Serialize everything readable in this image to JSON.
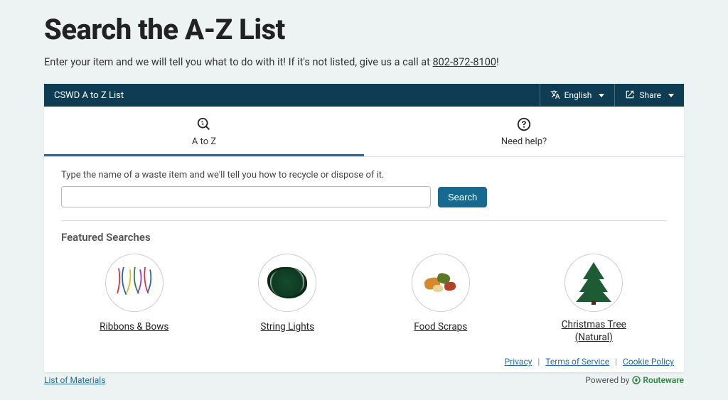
{
  "page": {
    "title": "Search the A-Z List",
    "intro_before": "Enter your item and we will tell you what to do with it! If it's not listed, give us a call at ",
    "phone": "802-872-8100",
    "intro_after": "!"
  },
  "widget": {
    "title": "CSWD A to Z List",
    "language_label": "English",
    "share_label": "Share"
  },
  "tabs": {
    "atoz": "A to Z",
    "help": "Need help?"
  },
  "search": {
    "label": "Type the name of a waste item and we'll tell you how to recycle or dispose of it.",
    "button": "Search",
    "value": ""
  },
  "featured": {
    "title": "Featured Searches",
    "items": [
      {
        "label": "Ribbons & Bows"
      },
      {
        "label": "String Lights"
      },
      {
        "label": "Food Scraps"
      },
      {
        "label": "Christmas Tree (Natural)"
      }
    ]
  },
  "footer": {
    "privacy": "Privacy",
    "terms": "Terms of Service",
    "cookie": "Cookie Policy"
  },
  "below": {
    "list_link": "List of Materials",
    "powered_prefix": "Powered by",
    "powered_brand": "Routeware"
  }
}
